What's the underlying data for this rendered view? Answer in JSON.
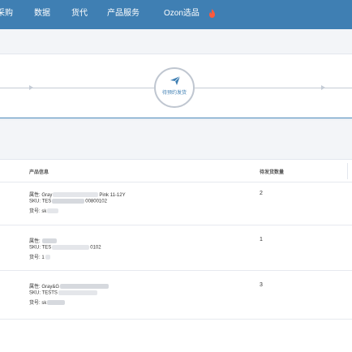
{
  "nav": {
    "items": [
      {
        "label": "采购"
      },
      {
        "label": "数据"
      },
      {
        "label": "货代"
      },
      {
        "label": "产品服务"
      },
      {
        "label": "Ozon选品"
      }
    ],
    "hot_icon": "flame-icon"
  },
  "steps": {
    "current_label": "待预约发货",
    "current_icon": "paper-plane-icon"
  },
  "table": {
    "columns": [
      "产品信息",
      "待发货数量"
    ],
    "rows": [
      {
        "attr_label": "属性:",
        "attr_value_start": "Gray",
        "attr_value_end": "Pink 11-12Y",
        "sku_label": "SKU:",
        "sku_value_start": "TES",
        "sku_value_end": "00800102",
        "code_label": "货号:",
        "code_value_start": "sk",
        "quantity": "2"
      },
      {
        "attr_label": "属性:",
        "attr_value_start": "",
        "attr_value_end": "",
        "sku_label": "SKU:",
        "sku_value_start": "TES",
        "sku_value_end": "0102",
        "code_label": "货号:",
        "code_value_start": "1",
        "quantity": "1"
      },
      {
        "attr_label": "属性:",
        "attr_value_start": "Gray&G",
        "attr_value_end": "",
        "sku_label": "SKU:",
        "sku_value_start": "TESTS",
        "sku_value_end": "",
        "code_label": "货号:",
        "code_value_start": "sk",
        "quantity": "3"
      }
    ]
  },
  "colors": {
    "topbar": "#3f7fb3",
    "page_bg": "#f3f5f8",
    "accent": "#3f7fb3",
    "flame": "#ff5a3c"
  }
}
